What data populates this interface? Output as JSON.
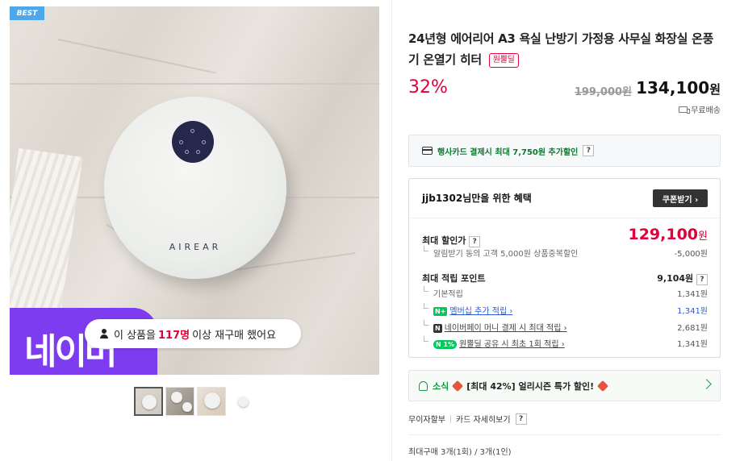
{
  "gallery": {
    "best_badge": "BEST",
    "device_brand": "AIREAR",
    "promo_banner": "네이버",
    "repurchase": {
      "pre": "이 상품을",
      "count": "117명",
      "post": "이상 재구매 했어요"
    },
    "thumbnails": [
      "thumb-1",
      "thumb-2",
      "thumb-3",
      "thumb-4"
    ]
  },
  "product": {
    "title": "24년형 에어리어 A3 욕실 난방기 가정용 사무실 화장실 온풍기 온열기 히터",
    "ontime_badge": "원뿔딜",
    "discount": "32%",
    "original_price": "199,000원",
    "sale_price": "134,100",
    "sale_currency": "원",
    "shipping": "무료배송"
  },
  "card_benefit": {
    "text": "행사카드 결제시 최대 7,750원 추가할인",
    "help": "?"
  },
  "benefit": {
    "heading": "jjb1302님만을 위한 혜택",
    "coupon_button": "쿠폰받기 ›",
    "max_discount_label": "최대 할인가",
    "max_discount_price": "129,100",
    "max_discount_currency": "원",
    "alarm_label": "알림받기 동의 고객 5,000원 상품중복할인",
    "alarm_value": "-5,000원",
    "points_label": "최대 적립 포인트",
    "points_value": "9,104원",
    "point_rows": [
      {
        "label": "기본적립",
        "value": "1,341원"
      },
      {
        "badge": "N+",
        "label": "멤버십 추가 적립 ›",
        "value": "1,341원"
      },
      {
        "badge": "N",
        "label": "네이버페이 머니 결제 시 최대 적립 ›",
        "value": "2,681원"
      },
      {
        "badge": "N 1%",
        "label": "원뿔딜 공유 시 최초 1회 적립 ›",
        "value": "1,341원"
      }
    ],
    "help": "?"
  },
  "news": {
    "label": "소식",
    "text": "[최대 42%] 얼리시즌 특가 할인!"
  },
  "payment": {
    "installment": "무이자할부",
    "card_detail": "카드 자세히보기",
    "help": "?"
  },
  "purchase_limit": "최대구매 3개(1회) / 3개(1인)"
}
